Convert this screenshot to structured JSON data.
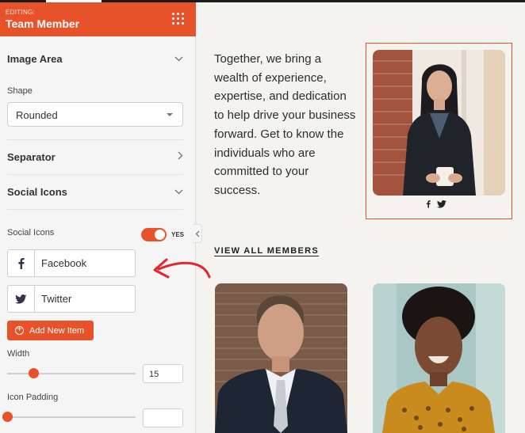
{
  "sidebar": {
    "editing_label": "EDITING:",
    "title": "Team Member",
    "sections": {
      "image_area": "Image Area",
      "separator": "Separator",
      "social_icons": "Social Icons"
    },
    "shape": {
      "label": "Shape",
      "value": "Rounded"
    },
    "social_icons_toggle": {
      "label": "Social Icons",
      "state": "YES"
    },
    "social_items": [
      {
        "icon": "facebook-icon",
        "name": "Facebook"
      },
      {
        "icon": "twitter-icon",
        "name": "Twitter"
      }
    ],
    "add_button_label": "Add New Item",
    "width": {
      "label": "Width",
      "value": "15",
      "level": 0.2
    },
    "icon_padding": {
      "label": "Icon Padding",
      "value": "",
      "level": 0
    }
  },
  "content": {
    "blurb": "Together, we bring a wealth of experience, expertise, and dedication to help drive your business forward. Get to know the individuals who are committed to your success.",
    "view_all": "VIEW ALL MEMBERS"
  },
  "colors": {
    "accent": "#e8522a",
    "canvas_bg": "#f4f3ef",
    "sidebar_bg": "#f5f5f5"
  }
}
